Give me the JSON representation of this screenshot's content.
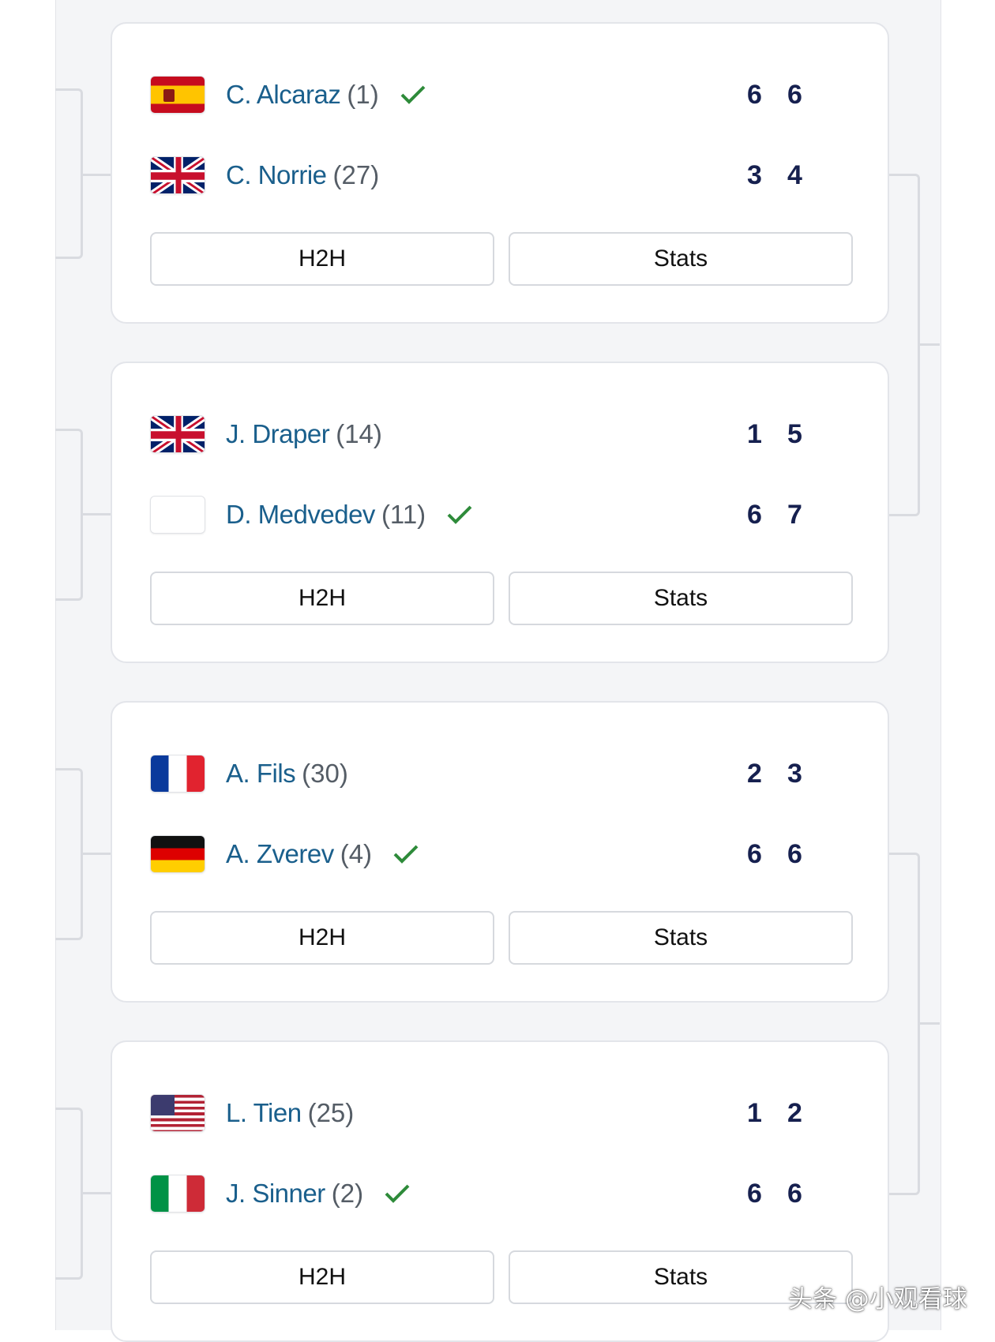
{
  "matches": [
    {
      "players": [
        {
          "name": "C. Alcaraz",
          "seed": "(1)",
          "flag": "spain-flag",
          "winner": true,
          "scores": [
            "6",
            "6"
          ]
        },
        {
          "name": "C. Norrie",
          "seed": "(27)",
          "flag": "uk-flag",
          "winner": false,
          "scores": [
            "3",
            "4"
          ]
        }
      ],
      "h2h_label": "H2H",
      "stats_label": "Stats"
    },
    {
      "players": [
        {
          "name": "J. Draper",
          "seed": "(14)",
          "flag": "uk-flag",
          "winner": false,
          "scores": [
            "1",
            "5"
          ]
        },
        {
          "name": "D. Medvedev",
          "seed": "(11)",
          "flag": "blank-flag",
          "winner": true,
          "scores": [
            "6",
            "7"
          ]
        }
      ],
      "h2h_label": "H2H",
      "stats_label": "Stats"
    },
    {
      "players": [
        {
          "name": "A. Fils",
          "seed": "(30)",
          "flag": "france-flag",
          "winner": false,
          "scores": [
            "2",
            "3"
          ]
        },
        {
          "name": "A. Zverev",
          "seed": "(4)",
          "flag": "germany-flag",
          "winner": true,
          "scores": [
            "6",
            "6"
          ]
        }
      ],
      "h2h_label": "H2H",
      "stats_label": "Stats"
    },
    {
      "players": [
        {
          "name": "L. Tien",
          "seed": "(25)",
          "flag": "usa-flag",
          "winner": false,
          "scores": [
            "1",
            "2"
          ]
        },
        {
          "name": "J. Sinner",
          "seed": "(2)",
          "flag": "italy-flag",
          "winner": true,
          "scores": [
            "6",
            "6"
          ]
        }
      ],
      "h2h_label": "H2H",
      "stats_label": "Stats"
    }
  ],
  "colors": {
    "player_name": "#1a5f8c",
    "score": "#16204f",
    "winner_check": "#2e8b3a"
  },
  "watermark": "头条 @小观看球"
}
